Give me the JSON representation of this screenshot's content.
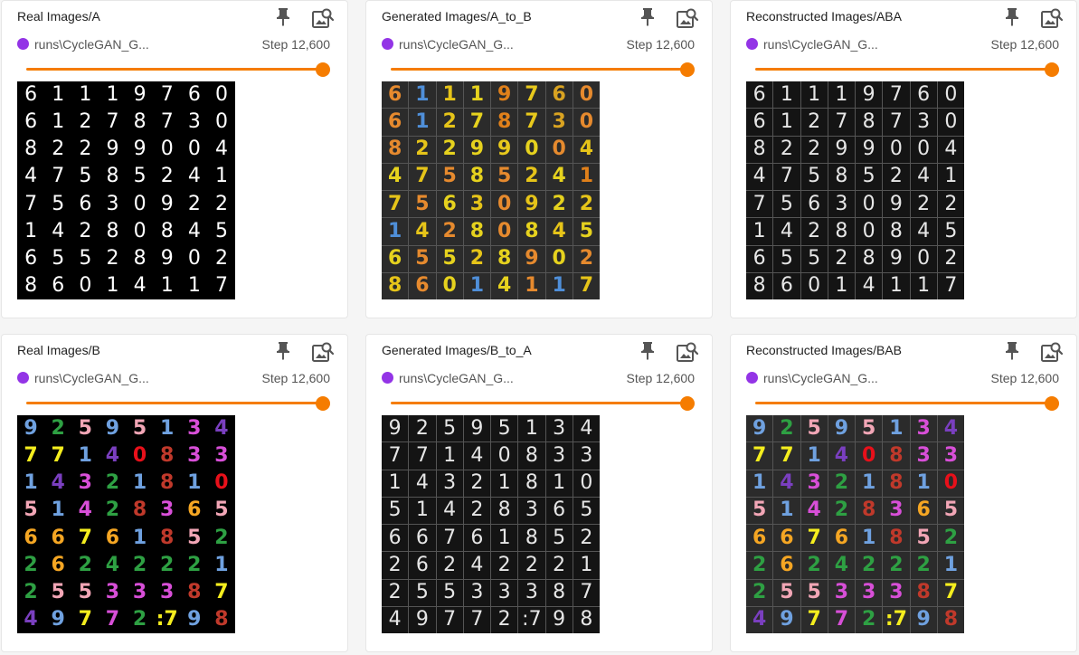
{
  "panel_common": {
    "run": "runs\\CycleGAN_G...",
    "step": "Step 12,600",
    "run_color": "#9334e6",
    "slider_color": "#f57c00",
    "slider_position": 1.0
  },
  "cards": [
    {
      "title": "Real Images/A",
      "style": "mono",
      "tiled": false,
      "background": "#000000",
      "digits": [
        "6",
        "1",
        "1",
        "1",
        "9",
        "7",
        "6",
        "0",
        "6",
        "1",
        "2",
        "7",
        "8",
        "7",
        "3",
        "0",
        "8",
        "2",
        "2",
        "9",
        "9",
        "0",
        "0",
        "4",
        "4",
        "7",
        "5",
        "8",
        "5",
        "2",
        "4",
        "1",
        "7",
        "5",
        "6",
        "3",
        "0",
        "9",
        "2",
        "2",
        "1",
        "4",
        "2",
        "8",
        "0",
        "8",
        "4",
        "5",
        "6",
        "5",
        "5",
        "2",
        "8",
        "9",
        "0",
        "2",
        "8",
        "6",
        "0",
        "1",
        "4",
        "1",
        "1",
        "7"
      ]
    },
    {
      "title": "Generated Images/A_to_B",
      "style": "color",
      "tiled": true,
      "background": "#2b2b2b",
      "digits": [
        "6",
        "1",
        "1",
        "1",
        "9",
        "7",
        "6",
        "0",
        "6",
        "1",
        "2",
        "7",
        "8",
        "7",
        "3",
        "0",
        "8",
        "2",
        "2",
        "9",
        "9",
        "0",
        "0",
        "4",
        "4",
        "7",
        "5",
        "8",
        "5",
        "2",
        "4",
        "1",
        "7",
        "5",
        "6",
        "3",
        "0",
        "9",
        "2",
        "2",
        "1",
        "4",
        "2",
        "8",
        "0",
        "8",
        "4",
        "5",
        "6",
        "5",
        "5",
        "2",
        "8",
        "9",
        "0",
        "2",
        "8",
        "6",
        "0",
        "1",
        "4",
        "1",
        "1",
        "7"
      ],
      "colors": [
        "#e68a2e",
        "#4f8fd9",
        "#e6c419",
        "#e6d21e",
        "#e0801a",
        "#e8c91c",
        "#d9a321",
        "#e68a2e",
        "#e68a2e",
        "#4f8fd9",
        "#e6c419",
        "#e6d21e",
        "#e0801a",
        "#e8c91c",
        "#d9a321",
        "#e68a2e",
        "#e68a2e",
        "#e6c419",
        "#e6d21e",
        "#e6d21e",
        "#e8c91c",
        "#e6d21e",
        "#e68a2e",
        "#e6c419",
        "#e6d21e",
        "#e6c419",
        "#e68a2e",
        "#e6d21e",
        "#e68a2e",
        "#e6c419",
        "#e6d21e",
        "#e0801a",
        "#e6c419",
        "#e68a2e",
        "#e6d21e",
        "#e6c419",
        "#e68a2e",
        "#e6c419",
        "#e6d21e",
        "#e6c419",
        "#4f8fd9",
        "#e6c419",
        "#e68a2e",
        "#e6d21e",
        "#e68a2e",
        "#e6d21e",
        "#e6c419",
        "#e6d21e",
        "#e6d21e",
        "#e68a2e",
        "#e6d21e",
        "#e6c419",
        "#e6d21e",
        "#e68a2e",
        "#e6d21e",
        "#e68a2e",
        "#e6c419",
        "#e68a2e",
        "#e6d21e",
        "#4f8fd9",
        "#e6d21e",
        "#e68a2e",
        "#4f8fd9",
        "#e6c419"
      ]
    },
    {
      "title": "Reconstructed Images/ABA",
      "style": "mono",
      "tiled": true,
      "background": "#141414",
      "digits": [
        "6",
        "1",
        "1",
        "1",
        "9",
        "7",
        "6",
        "0",
        "6",
        "1",
        "2",
        "7",
        "8",
        "7",
        "3",
        "0",
        "8",
        "2",
        "2",
        "9",
        "9",
        "0",
        "0",
        "4",
        "4",
        "7",
        "5",
        "8",
        "5",
        "2",
        "4",
        "1",
        "7",
        "5",
        "6",
        "3",
        "0",
        "9",
        "2",
        "2",
        "1",
        "4",
        "2",
        "8",
        "0",
        "8",
        "4",
        "5",
        "6",
        "5",
        "5",
        "2",
        "8",
        "9",
        "0",
        "2",
        "8",
        "6",
        "0",
        "1",
        "4",
        "1",
        "1",
        "7"
      ]
    },
    {
      "title": "Real Images/B",
      "style": "color",
      "tiled": false,
      "background": "#000000",
      "digits": [
        "9",
        "2",
        "5",
        "9",
        "5",
        "1",
        "3",
        "4",
        "7",
        "7",
        "1",
        "4",
        "0",
        "8",
        "3",
        "3",
        "1",
        "4",
        "3",
        "2",
        "1",
        "8",
        "1",
        "0",
        "5",
        "1",
        "4",
        "2",
        "8",
        "3",
        "6",
        "5",
        "6",
        "6",
        "7",
        "6",
        "1",
        "8",
        "5",
        "2",
        "2",
        "6",
        "2",
        "4",
        "2",
        "2",
        "2",
        "1",
        "2",
        "5",
        "5",
        "3",
        "3",
        "3",
        "8",
        "7",
        "4",
        "9",
        "7",
        "7",
        "2",
        ":7",
        "9",
        "8"
      ],
      "colors": [
        "#6fa1e0",
        "#2ea043",
        "#f2a6b6",
        "#6fa1e0",
        "#f2a6b6",
        "#6fa1e0",
        "#d84fd8",
        "#7a3fbf",
        "#f5ee1e",
        "#f5ee1e",
        "#6fa1e0",
        "#7a3fbf",
        "#e8101a",
        "#c0392b",
        "#d84fd8",
        "#d84fd8",
        "#6fa1e0",
        "#7a3fbf",
        "#d84fd8",
        "#2ea043",
        "#6fa1e0",
        "#c0392b",
        "#6fa1e0",
        "#e8101a",
        "#f2a6b6",
        "#6fa1e0",
        "#d84fd8",
        "#2ea043",
        "#c0392b",
        "#d84fd8",
        "#f5a623",
        "#f2a6b6",
        "#f5a623",
        "#f5a623",
        "#f5ee1e",
        "#f5a623",
        "#6fa1e0",
        "#c0392b",
        "#f2a6b6",
        "#2ea043",
        "#2ea043",
        "#f5a623",
        "#2ea043",
        "#2ea043",
        "#2ea043",
        "#2ea043",
        "#2ea043",
        "#6fa1e0",
        "#2ea043",
        "#f2a6b6",
        "#f2a6b6",
        "#d84fd8",
        "#d84fd8",
        "#d84fd8",
        "#c0392b",
        "#f5ee1e",
        "#7a3fbf",
        "#6fa1e0",
        "#f5ee1e",
        "#d84fd8",
        "#2ea043",
        "#f5ee1e",
        "#6fa1e0",
        "#c0392b"
      ]
    },
    {
      "title": "Generated Images/B_to_A",
      "style": "mono",
      "tiled": true,
      "background": "#141414",
      "digits": [
        "9",
        "2",
        "5",
        "9",
        "5",
        "1",
        "3",
        "4",
        "7",
        "7",
        "1",
        "4",
        "0",
        "8",
        "3",
        "3",
        "1",
        "4",
        "3",
        "2",
        "1",
        "8",
        "1",
        "0",
        "5",
        "1",
        "4",
        "2",
        "8",
        "3",
        "6",
        "5",
        "6",
        "6",
        "7",
        "6",
        "1",
        "8",
        "5",
        "2",
        "2",
        "6",
        "2",
        "4",
        "2",
        "2",
        "2",
        "1",
        "2",
        "5",
        "5",
        "3",
        "3",
        "3",
        "8",
        "7",
        "4",
        "9",
        "7",
        "7",
        "2",
        ":7",
        "9",
        "8"
      ]
    },
    {
      "title": "Reconstructed Images/BAB",
      "style": "color",
      "tiled": true,
      "background": "#2b2b2b",
      "digits": [
        "9",
        "2",
        "5",
        "9",
        "5",
        "1",
        "3",
        "4",
        "7",
        "7",
        "1",
        "4",
        "0",
        "8",
        "3",
        "3",
        "1",
        "4",
        "3",
        "2",
        "1",
        "8",
        "1",
        "0",
        "5",
        "1",
        "4",
        "2",
        "8",
        "3",
        "6",
        "5",
        "6",
        "6",
        "7",
        "6",
        "1",
        "8",
        "5",
        "2",
        "2",
        "6",
        "2",
        "4",
        "2",
        "2",
        "2",
        "1",
        "2",
        "5",
        "5",
        "3",
        "3",
        "3",
        "8",
        "7",
        "4",
        "9",
        "7",
        "7",
        "2",
        ":7",
        "9",
        "8"
      ],
      "colors": [
        "#6fa1e0",
        "#2ea043",
        "#f2a6b6",
        "#6fa1e0",
        "#f2a6b6",
        "#6fa1e0",
        "#d84fd8",
        "#7a3fbf",
        "#f5ee1e",
        "#f5ee1e",
        "#6fa1e0",
        "#7a3fbf",
        "#e8101a",
        "#c0392b",
        "#d84fd8",
        "#d84fd8",
        "#6fa1e0",
        "#7a3fbf",
        "#d84fd8",
        "#2ea043",
        "#6fa1e0",
        "#c0392b",
        "#6fa1e0",
        "#e8101a",
        "#f2a6b6",
        "#6fa1e0",
        "#d84fd8",
        "#2ea043",
        "#c0392b",
        "#d84fd8",
        "#f5a623",
        "#f2a6b6",
        "#f5a623",
        "#f5a623",
        "#f5ee1e",
        "#f5a623",
        "#6fa1e0",
        "#c0392b",
        "#f2a6b6",
        "#2ea043",
        "#2ea043",
        "#f5a623",
        "#2ea043",
        "#2ea043",
        "#2ea043",
        "#2ea043",
        "#2ea043",
        "#6fa1e0",
        "#2ea043",
        "#f2a6b6",
        "#f2a6b6",
        "#d84fd8",
        "#d84fd8",
        "#d84fd8",
        "#c0392b",
        "#f5ee1e",
        "#7a3fbf",
        "#6fa1e0",
        "#f5ee1e",
        "#d84fd8",
        "#2ea043",
        "#f5ee1e",
        "#6fa1e0",
        "#c0392b"
      ]
    }
  ]
}
